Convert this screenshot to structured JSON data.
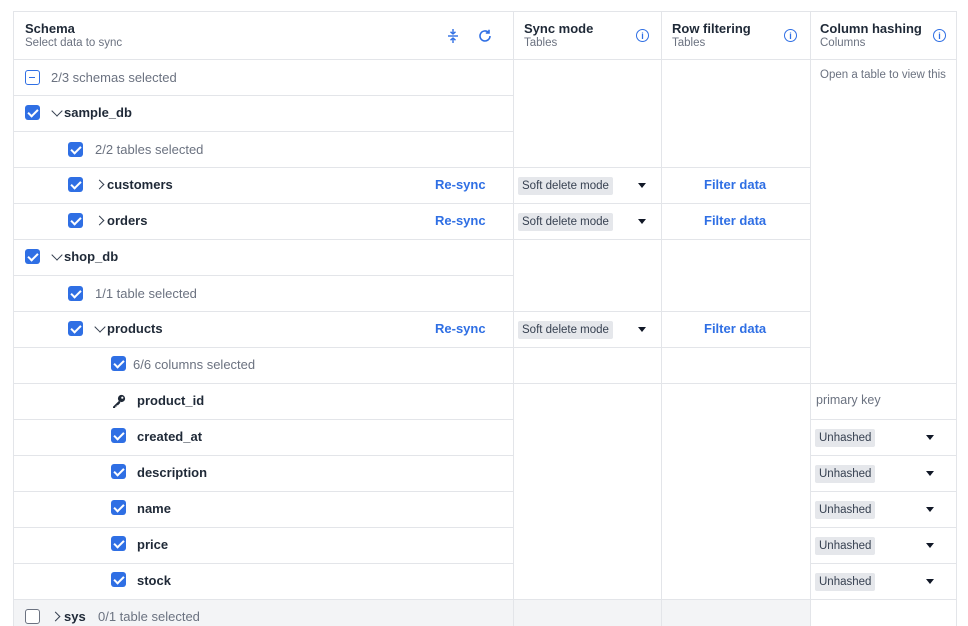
{
  "header": {
    "schema_title": "Schema",
    "schema_sub": "Select data to sync",
    "sync_title": "Sync mode",
    "sync_sub": "Tables",
    "filter_title": "Row filtering",
    "filter_sub": "Tables",
    "hash_title": "Column hashing",
    "hash_sub": "Columns"
  },
  "summary": "2/3 schemas selected",
  "hash_hint": "Open a table to view this",
  "schemas": [
    {
      "name": "sample_db",
      "tables_selected": "2/2 tables selected",
      "tables": [
        {
          "name": "customers",
          "resync": "Re-sync",
          "mode": "Soft delete mode",
          "filter": "Filter data"
        },
        {
          "name": "orders",
          "resync": "Re-sync",
          "mode": "Soft delete mode",
          "filter": "Filter data"
        }
      ]
    },
    {
      "name": "shop_db",
      "tables_selected": "1/1 table selected",
      "tables": [
        {
          "name": "products",
          "resync": "Re-sync",
          "mode": "Soft delete mode",
          "filter": "Filter data",
          "columns_selected": "6/6 columns selected",
          "columns": [
            {
              "name": "product_id",
              "hash": "primary key"
            },
            {
              "name": "created_at",
              "hash": "Unhashed"
            },
            {
              "name": "description",
              "hash": "Unhashed"
            },
            {
              "name": "name",
              "hash": "Unhashed"
            },
            {
              "name": "price",
              "hash": "Unhashed"
            },
            {
              "name": "stock",
              "hash": "Unhashed"
            }
          ]
        }
      ]
    },
    {
      "name": "sys",
      "tables_selected": "0/1 table selected"
    }
  ],
  "icons": {
    "collapse": "collapse-all-icon",
    "refresh": "refresh-icon",
    "info": "info-icon",
    "key": "key-icon"
  },
  "colors": {
    "accent": "#2f6fe4",
    "border": "#e3e5e9",
    "tag_bg": "#e5e7eb"
  }
}
